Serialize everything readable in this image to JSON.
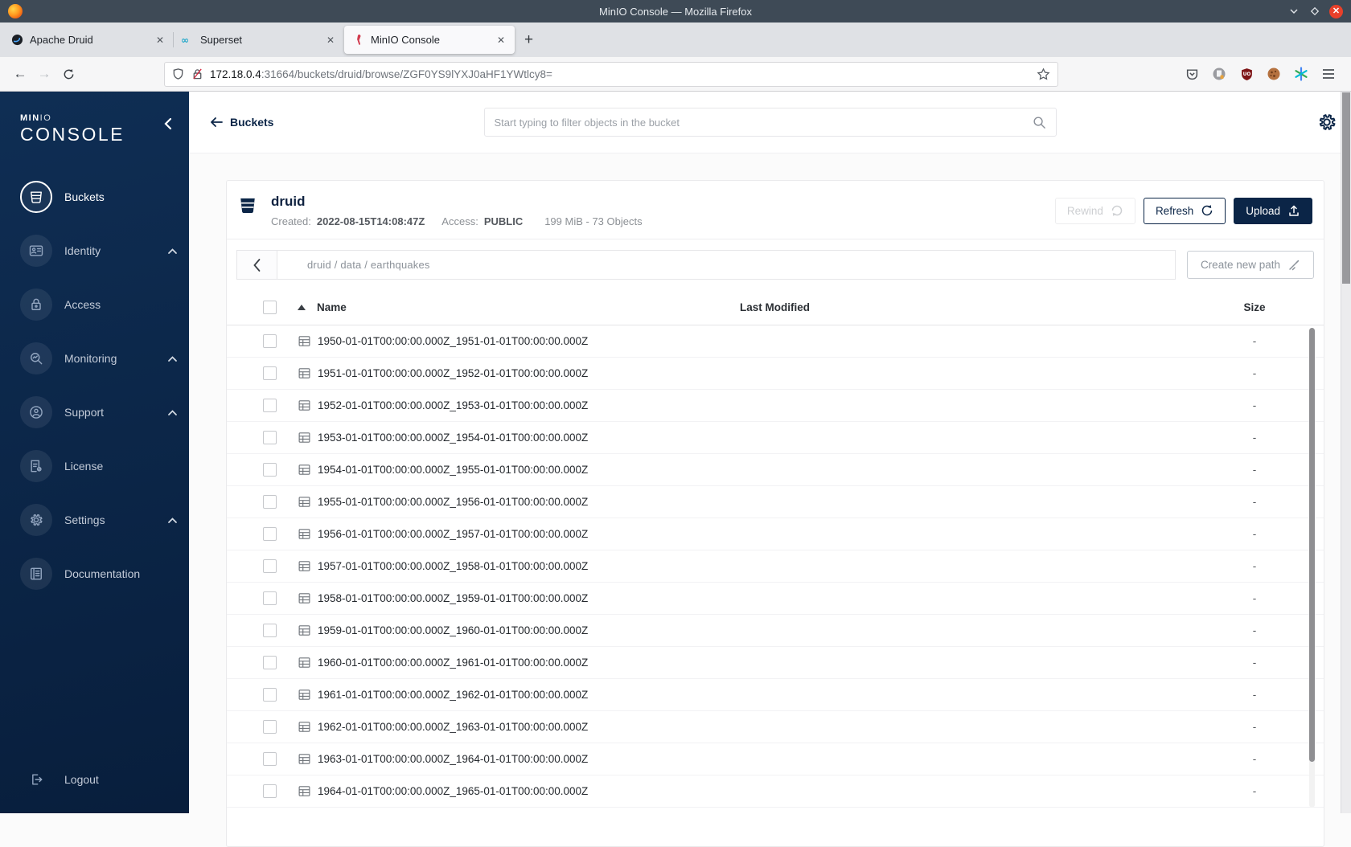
{
  "browser": {
    "window_title": "MinIO Console — Mozilla Firefox",
    "tabs": [
      {
        "label": "Apache Druid",
        "favicon": "druid-favicon",
        "close": "✕"
      },
      {
        "label": "Superset",
        "favicon": "superset-favicon",
        "close": "✕"
      },
      {
        "label": "MinIO Console",
        "favicon": "minio-favicon",
        "close": "✕"
      }
    ],
    "new_tab_label": "+",
    "url_host": "172.18.0.4",
    "url_rest": ":31664/buckets/druid/browse/ZGF0YS9lYXJ0aHF1YWtlcy8="
  },
  "sidebar": {
    "logo_bold": "MIN",
    "logo_thin": "IO",
    "logo_main": "CONSOLE",
    "items": [
      {
        "label": "Buckets",
        "icon": "bucket",
        "active": true,
        "expandable": false
      },
      {
        "label": "Identity",
        "icon": "identity-card",
        "active": false,
        "expandable": true
      },
      {
        "label": "Access",
        "icon": "lock",
        "active": false,
        "expandable": false
      },
      {
        "label": "Monitoring",
        "icon": "monitor-search",
        "active": false,
        "expandable": true
      },
      {
        "label": "Support",
        "icon": "support",
        "active": false,
        "expandable": true
      },
      {
        "label": "License",
        "icon": "license",
        "active": false,
        "expandable": false
      },
      {
        "label": "Settings",
        "icon": "gear",
        "active": false,
        "expandable": true
      },
      {
        "label": "Documentation",
        "icon": "docs",
        "active": false,
        "expandable": false
      }
    ],
    "logout_label": "Logout"
  },
  "header": {
    "back_label": "Buckets",
    "search_placeholder": "Start typing to filter objects in the bucket"
  },
  "bucket": {
    "name": "druid",
    "created_label": "Created:",
    "created_value": "2022-08-15T14:08:47Z",
    "access_label": "Access:",
    "access_value": "PUBLIC",
    "summary": "199 MiB - 73 Objects",
    "rewind_label": "Rewind",
    "refresh_label": "Refresh",
    "upload_label": "Upload"
  },
  "browse": {
    "breadcrumb": "druid / data / earthquakes",
    "create_path_label": "Create new path",
    "columns": {
      "name": "Name",
      "last_modified": "Last Modified",
      "size": "Size"
    },
    "rows": [
      {
        "name": "1950-01-01T00:00:00.000Z_1951-01-01T00:00:00.000Z",
        "last_modified": "",
        "size": "-"
      },
      {
        "name": "1951-01-01T00:00:00.000Z_1952-01-01T00:00:00.000Z",
        "last_modified": "",
        "size": "-"
      },
      {
        "name": "1952-01-01T00:00:00.000Z_1953-01-01T00:00:00.000Z",
        "last_modified": "",
        "size": "-"
      },
      {
        "name": "1953-01-01T00:00:00.000Z_1954-01-01T00:00:00.000Z",
        "last_modified": "",
        "size": "-"
      },
      {
        "name": "1954-01-01T00:00:00.000Z_1955-01-01T00:00:00.000Z",
        "last_modified": "",
        "size": "-"
      },
      {
        "name": "1955-01-01T00:00:00.000Z_1956-01-01T00:00:00.000Z",
        "last_modified": "",
        "size": "-"
      },
      {
        "name": "1956-01-01T00:00:00.000Z_1957-01-01T00:00:00.000Z",
        "last_modified": "",
        "size": "-"
      },
      {
        "name": "1957-01-01T00:00:00.000Z_1958-01-01T00:00:00.000Z",
        "last_modified": "",
        "size": "-"
      },
      {
        "name": "1958-01-01T00:00:00.000Z_1959-01-01T00:00:00.000Z",
        "last_modified": "",
        "size": "-"
      },
      {
        "name": "1959-01-01T00:00:00.000Z_1960-01-01T00:00:00.000Z",
        "last_modified": "",
        "size": "-"
      },
      {
        "name": "1960-01-01T00:00:00.000Z_1961-01-01T00:00:00.000Z",
        "last_modified": "",
        "size": "-"
      },
      {
        "name": "1961-01-01T00:00:00.000Z_1962-01-01T00:00:00.000Z",
        "last_modified": "",
        "size": "-"
      },
      {
        "name": "1962-01-01T00:00:00.000Z_1963-01-01T00:00:00.000Z",
        "last_modified": "",
        "size": "-"
      },
      {
        "name": "1963-01-01T00:00:00.000Z_1964-01-01T00:00:00.000Z",
        "last_modified": "",
        "size": "-"
      },
      {
        "name": "1964-01-01T00:00:00.000Z_1965-01-01T00:00:00.000Z",
        "last_modified": "",
        "size": "-"
      }
    ]
  },
  "colors": {
    "accent_navy": "#0b2547",
    "sidebar_top": "#0f2e54",
    "sidebar_bottom": "#081e3c",
    "titlebar": "#3e4a56",
    "close_red": "#e8402a",
    "ublock_red": "#7e1416"
  }
}
